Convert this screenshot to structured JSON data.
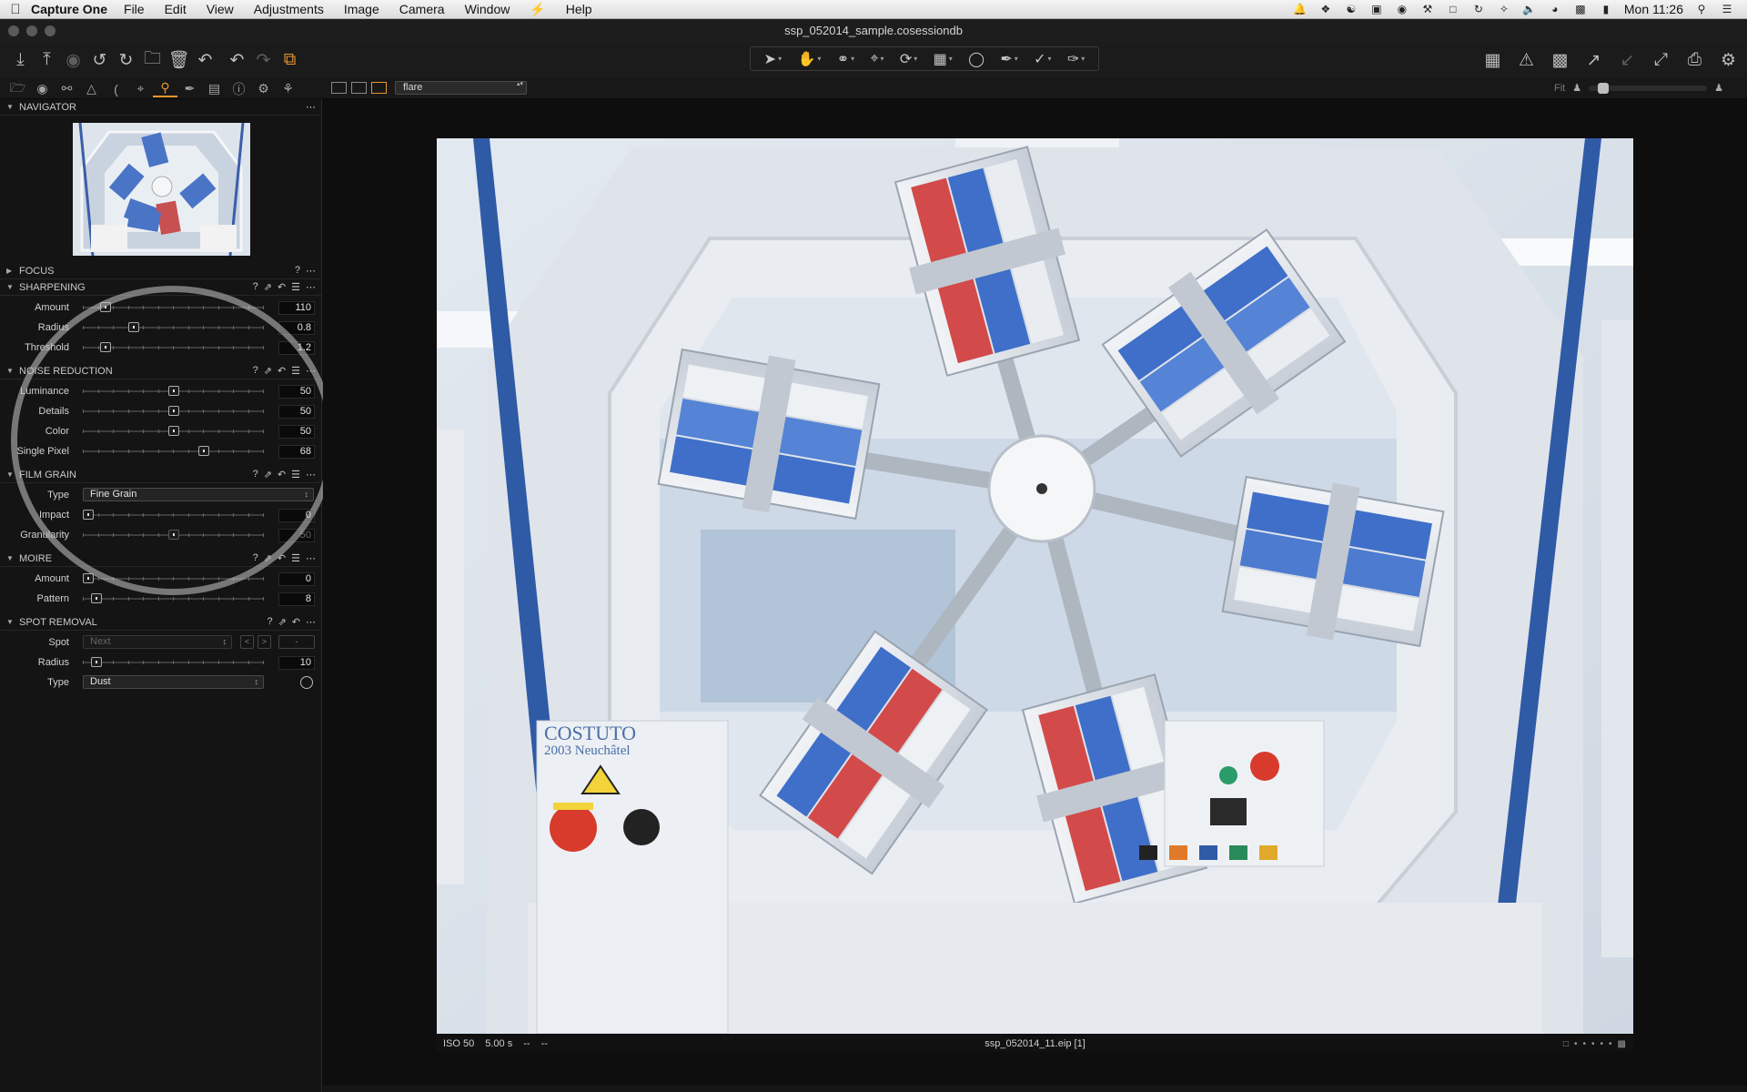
{
  "menubar": {
    "app_name": "Capture One",
    "menus": [
      "File",
      "Edit",
      "View",
      "Adjustments",
      "Image",
      "Camera",
      "Window",
      "Help"
    ],
    "clock": "Mon 11:26"
  },
  "window": {
    "title": "ssp_052014_sample.cosessiondb"
  },
  "viewer_bar": {
    "style_value": "flare",
    "zoom_label": "Fit"
  },
  "panels": {
    "navigator": {
      "title": "NAVIGATOR"
    },
    "focus": {
      "title": "FOCUS"
    },
    "sharpening": {
      "title": "SHARPENING",
      "amount": {
        "label": "Amount",
        "value": "110",
        "level": 0.1
      },
      "radius": {
        "label": "Radius",
        "value": "0.8",
        "level": 0.27
      },
      "threshold": {
        "label": "Threshold",
        "value": "1.2",
        "level": 0.1
      }
    },
    "noise_reduction": {
      "title": "NOISE REDUCTION",
      "luminance": {
        "label": "Luminance",
        "value": "50",
        "level": 0.5
      },
      "details": {
        "label": "Details",
        "value": "50",
        "level": 0.5
      },
      "color": {
        "label": "Color",
        "value": "50",
        "level": 0.5
      },
      "single_pixel": {
        "label": "Single Pixel",
        "value": "68",
        "level": 0.68
      }
    },
    "film_grain": {
      "title": "FILM GRAIN",
      "type_label": "Type",
      "type_value": "Fine Grain",
      "impact": {
        "label": "Impact",
        "value": "0",
        "level": 0.0
      },
      "granularity": {
        "label": "Granularity",
        "value": "50",
        "level": 0.5
      }
    },
    "moire": {
      "title": "MOIRE",
      "amount": {
        "label": "Amount",
        "value": "0",
        "level": 0.0
      },
      "pattern": {
        "label": "Pattern",
        "value": "8",
        "level": 0.05
      }
    },
    "spot_removal": {
      "title": "SPOT REMOVAL",
      "spot_label": "Spot",
      "spot_value": "Next",
      "spot_prev": "<",
      "spot_next": ">",
      "spot_minus": "-",
      "radius": {
        "label": "Radius",
        "value": "10",
        "level": 0.05
      },
      "type_label": "Type",
      "type_value": "Dust"
    }
  },
  "photo": {
    "brand_text": "COSTUTO",
    "brand_sub": "2003 Neuchâtel"
  },
  "photo_info": {
    "iso": "ISO 50",
    "shutter": "5.00 s",
    "aperture": "--",
    "focal": "--",
    "filename": "ssp_052014_11.eip [1]"
  },
  "colors": {
    "accent": "#e8962e",
    "panel_bg": "#141414",
    "viewer_bg": "#0e0e0e"
  }
}
